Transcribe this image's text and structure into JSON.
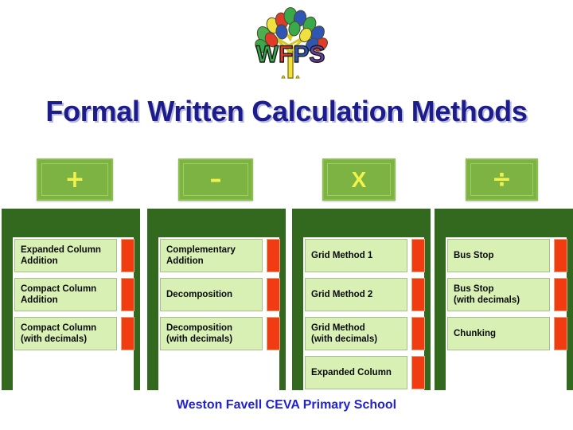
{
  "title": "Formal Written Calculation Methods",
  "footer": "Weston Favell CEVA Primary School",
  "logo": {
    "name": "wfps-tree-logo",
    "text": "WFPS",
    "alt": "Weston Favell Primary School tree logo"
  },
  "colors": {
    "title_blue": "#1c1c8c",
    "footer_blue": "#2222cc",
    "panel_green": "#33691e",
    "button_green": "#7cb342",
    "glyph_yellow": "#f2f24a",
    "item_green": "#d8f0b4",
    "chip_orange": "#f03c10"
  },
  "operations": [
    {
      "icon": "plus-icon",
      "symbol": "+",
      "label": "Addition"
    },
    {
      "icon": "minus-icon",
      "symbol": "–",
      "label": "Subtraction"
    },
    {
      "icon": "multiply-icon",
      "symbol": "X",
      "label": "Multiplication"
    },
    {
      "icon": "divide-icon",
      "symbol": "÷",
      "label": "Division"
    }
  ],
  "columns": [
    {
      "op": "addition",
      "items": [
        {
          "label": "Expanded Column\nAddition"
        },
        {
          "label": "Compact Column\nAddition"
        },
        {
          "label": "Compact Column\n(with decimals)"
        }
      ]
    },
    {
      "op": "subtraction",
      "items": [
        {
          "label": "Complementary\nAddition"
        },
        {
          "label": "Decomposition"
        },
        {
          "label": "Decomposition\n(with decimals)"
        }
      ]
    },
    {
      "op": "multiplication",
      "items": [
        {
          "label": "Grid Method 1"
        },
        {
          "label": "Grid Method 2"
        },
        {
          "label": "Grid Method\n(with decimals)"
        },
        {
          "label": "Expanded Column"
        }
      ]
    },
    {
      "op": "division",
      "items": [
        {
          "label": "Bus Stop"
        },
        {
          "label": "Bus Stop\n(with decimals)"
        },
        {
          "label": "Chunking"
        }
      ]
    }
  ]
}
